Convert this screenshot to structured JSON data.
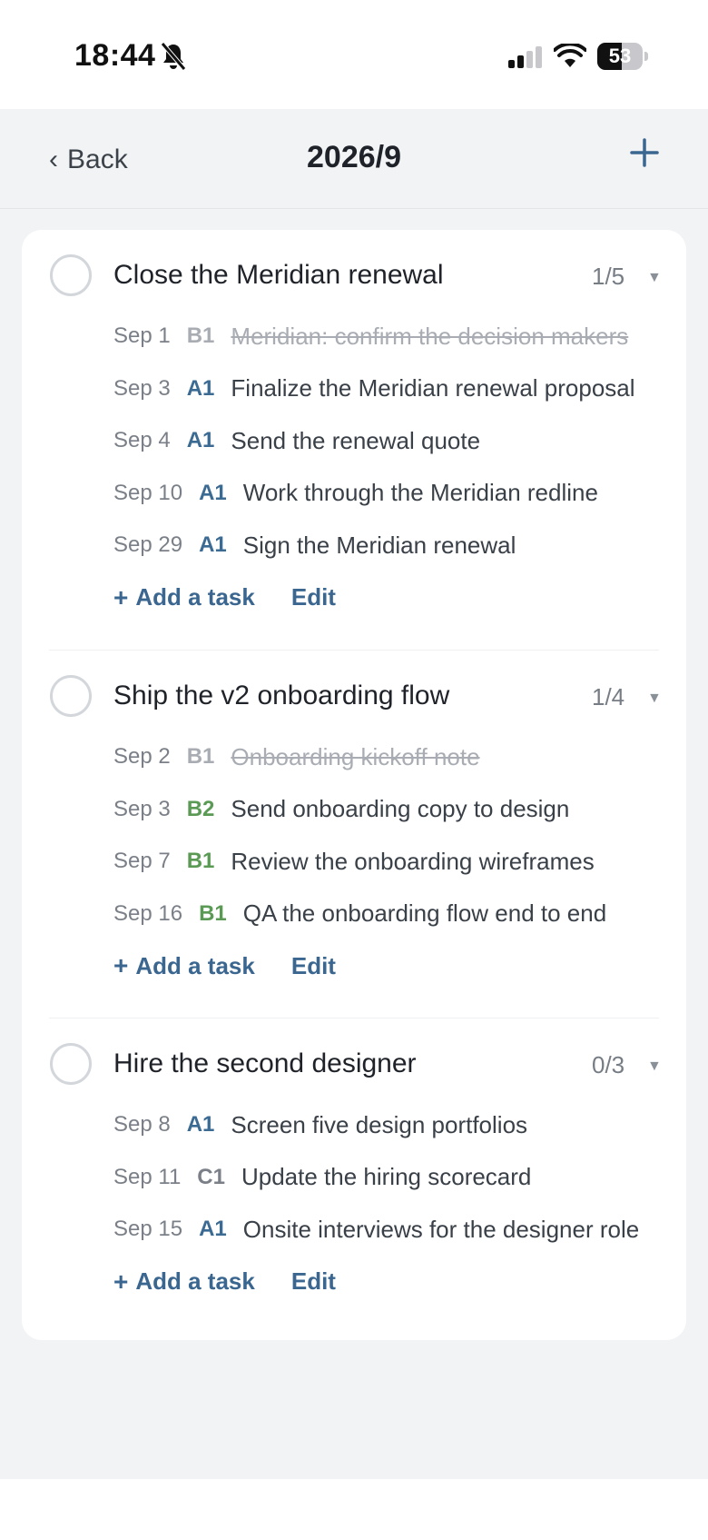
{
  "status_bar": {
    "time": "18:44",
    "battery_level": "53",
    "battery_fraction": 0.53,
    "icons": [
      "bell-off-icon",
      "signal-icon",
      "wifi-icon",
      "battery-icon"
    ]
  },
  "nav": {
    "back_label": "Back",
    "title": "2026/9",
    "add_icon": "plus-icon"
  },
  "colors": {
    "accent": "#3a6690",
    "prio_a": "#3b6a93",
    "prio_b_muted": "#9aa0a6",
    "prio_b_green": "#5a9a55",
    "prio_c": "#7b8088"
  },
  "goals": [
    {
      "title": "Close the Meridian renewal",
      "count": "1/5",
      "tasks": [
        {
          "date": "Sep 1",
          "priority": "B1",
          "title": "Meridian: confirm the decision makers",
          "done": true,
          "prio_color": "#a9adb3"
        },
        {
          "date": "Sep 3",
          "priority": "A1",
          "title": "Finalize the Meridian renewal proposal",
          "done": false,
          "prio_color": "#3b6a93"
        },
        {
          "date": "Sep 4",
          "priority": "A1",
          "title": "Send the renewal quote",
          "done": false,
          "prio_color": "#3b6a93"
        },
        {
          "date": "Sep 10",
          "priority": "A1",
          "title": "Work through the Meridian redline",
          "done": false,
          "prio_color": "#3b6a93"
        },
        {
          "date": "Sep 29",
          "priority": "A1",
          "title": "Sign the Meridian renewal",
          "done": false,
          "prio_color": "#3b6a93"
        }
      ],
      "add_label": "Add a task",
      "edit_label": "Edit"
    },
    {
      "title": "Ship the v2 onboarding flow",
      "count": "1/4",
      "tasks": [
        {
          "date": "Sep 2",
          "priority": "B1",
          "title": "Onboarding kickoff note",
          "done": true,
          "prio_color": "#a9adb3"
        },
        {
          "date": "Sep 3",
          "priority": "B2",
          "title": "Send onboarding copy to design",
          "done": false,
          "prio_color": "#5a9a55"
        },
        {
          "date": "Sep 7",
          "priority": "B1",
          "title": "Review the onboarding wireframes",
          "done": false,
          "prio_color": "#5a9a55"
        },
        {
          "date": "Sep 16",
          "priority": "B1",
          "title": "QA the onboarding flow end to end",
          "done": false,
          "prio_color": "#5a9a55"
        }
      ],
      "add_label": "Add a task",
      "edit_label": "Edit"
    },
    {
      "title": "Hire the second designer",
      "count": "0/3",
      "tasks": [
        {
          "date": "Sep 8",
          "priority": "A1",
          "title": "Screen five design portfolios",
          "done": false,
          "prio_color": "#3b6a93"
        },
        {
          "date": "Sep 11",
          "priority": "C1",
          "title": "Update the hiring scorecard",
          "done": false,
          "prio_color": "#7b8088"
        },
        {
          "date": "Sep 15",
          "priority": "A1",
          "title": "Onsite interviews for the designer role",
          "done": false,
          "prio_color": "#3b6a93"
        }
      ],
      "add_label": "Add a task",
      "edit_label": "Edit"
    }
  ]
}
